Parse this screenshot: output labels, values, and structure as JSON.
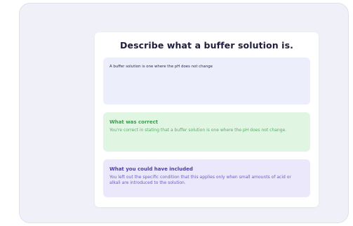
{
  "question": {
    "title": "Describe what a buffer solution is."
  },
  "answer": {
    "text": "A buffer solution is one where the pH does not change"
  },
  "feedback": {
    "correct": {
      "title": "What was correct",
      "text": "You're correct in stating that a buffer solution is one where the pH does not change.",
      "color": "#3f9b51",
      "background": "#e0f6e3"
    },
    "improve": {
      "title": "What you could have included",
      "text": "You left out the specific condition that this applies only when small amounts of acid or alkali are introduced to the solution.",
      "color": "#4b3fa8",
      "background": "#ebe8fb"
    }
  }
}
